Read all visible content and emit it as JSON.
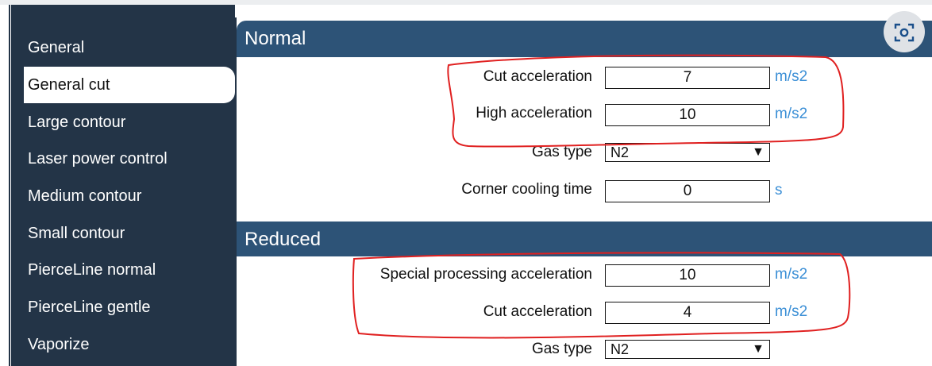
{
  "sidebar": {
    "items": [
      {
        "label": "General"
      },
      {
        "label": "General cut"
      },
      {
        "label": "Large contour"
      },
      {
        "label": "Laser power control"
      },
      {
        "label": "Medium contour"
      },
      {
        "label": "Small contour"
      },
      {
        "label": "PierceLine normal"
      },
      {
        "label": "PierceLine gentle"
      },
      {
        "label": "Vaporize"
      }
    ],
    "active": "General cut"
  },
  "normal": {
    "title": "Normal",
    "cut_accel": {
      "label": "Cut acceleration",
      "value": "7",
      "unit": "m/s2"
    },
    "high_accel": {
      "label": "High acceleration",
      "value": "10",
      "unit": "m/s2"
    },
    "gas_type": {
      "label": "Gas type",
      "value": "N2"
    },
    "corner_cooling": {
      "label": "Corner cooling time",
      "value": "0",
      "unit": "s"
    }
  },
  "reduced": {
    "title": "Reduced",
    "special_accel": {
      "label": "Special processing acceleration",
      "value": "10",
      "unit": "m/s2"
    },
    "cut_accel": {
      "label": "Cut acceleration",
      "value": "4",
      "unit": "m/s2"
    },
    "gas_type": {
      "label": "Gas type",
      "value": "N2"
    }
  },
  "icons": {
    "lens": "visual-search-icon",
    "dropdown": "triangle-down-icon"
  },
  "colors": {
    "sidebar_bg": "#233447",
    "header_bg": "#2d5377",
    "unit_text": "#3b8fd6",
    "annotation": "#e02020"
  }
}
